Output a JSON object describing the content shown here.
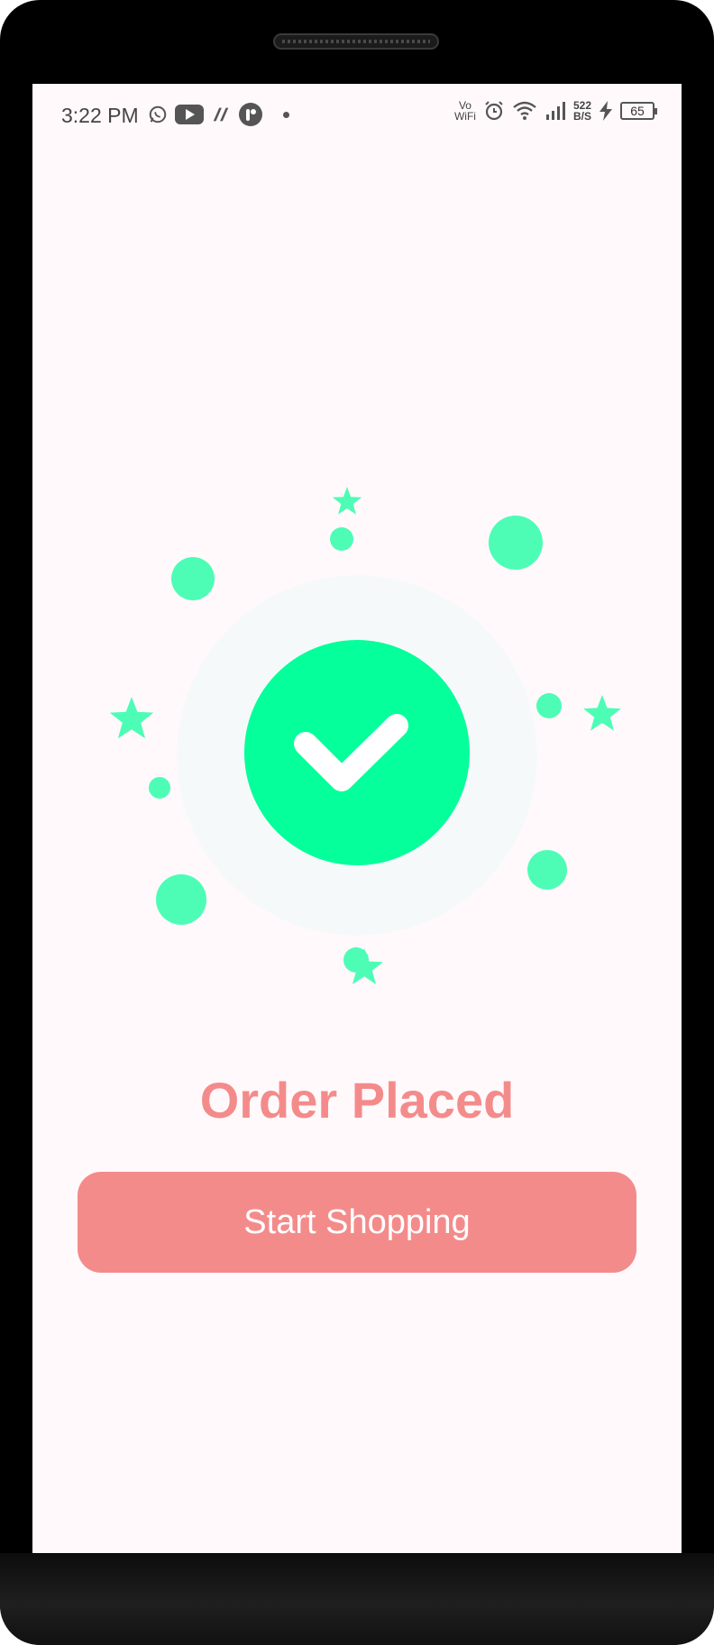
{
  "status_bar": {
    "time": "3:22 PM",
    "network_label_top": "Vo",
    "network_label_bottom": "WiFi",
    "speed_value": "522",
    "speed_unit": "B/S",
    "battery_level": "65"
  },
  "main": {
    "title": "Order Placed",
    "start_shopping_label": "Start Shopping"
  },
  "colors": {
    "accent_green": "#05ff9b",
    "accent_pink": "#f48b8b",
    "background": "#fff9fc"
  },
  "icons": [
    "whatsapp-icon",
    "youtube-icon",
    "app-icon",
    "app-r-icon",
    "alarm-icon",
    "wifi-icon",
    "signal-icon",
    "charging-icon",
    "battery-icon",
    "check-icon",
    "star-icon"
  ]
}
